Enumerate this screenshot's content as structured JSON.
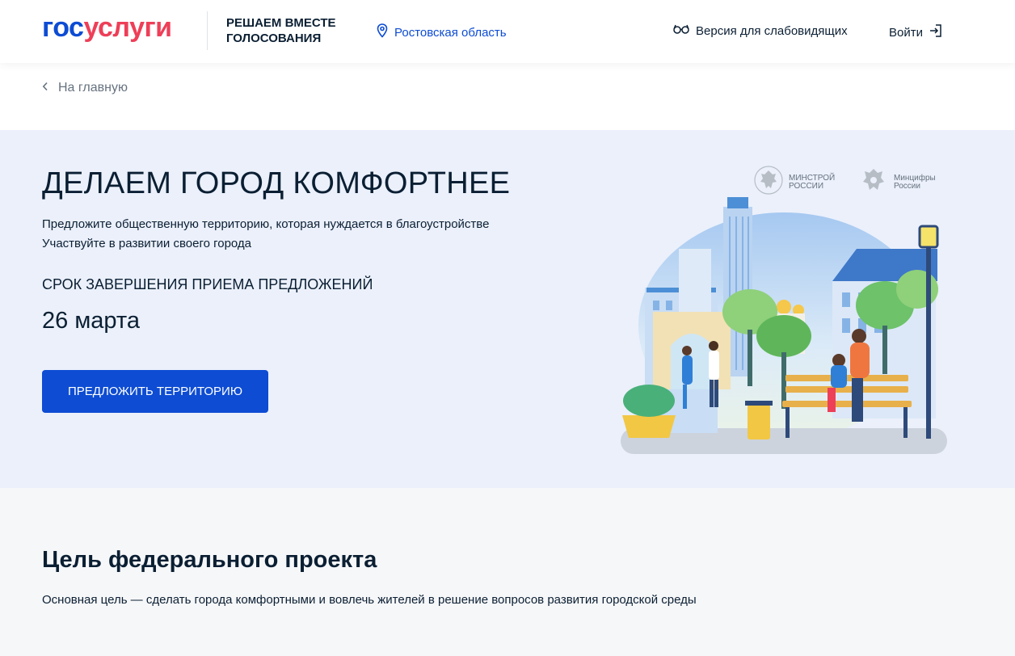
{
  "header": {
    "logo_part1": "гос",
    "logo_part2": "услуги",
    "project_line1": "РЕШАЕМ ВМЕСТЕ",
    "project_line2": "ГОЛОСОВАНИЯ",
    "region": "Ростовская область",
    "accessibility": "Версия для слабовидящих",
    "login": "Войти"
  },
  "breadcrumb": {
    "back": "На главную"
  },
  "hero": {
    "title": "ДЕЛАЕМ ГОРОД КОМФОРТНЕЕ",
    "subtitle1": "Предложите общественную территорию, которая нуждается в благоустройстве",
    "subtitle2": "Участвуйте в развитии своего города",
    "deadline_label": "СРОК ЗАВЕРШЕНИЯ ПРИЕМА ПРЕДЛОЖЕНИЙ",
    "deadline_date": "26 марта",
    "cta": "ПРЕДЛОЖИТЬ ТЕРРИТОРИЮ",
    "ministries": [
      "МИНСТРОЙ\nРОССИИ",
      "Минцифры\nРоссии"
    ]
  },
  "goal": {
    "title": "Цель федерального проекта",
    "text": "Основная цель — сделать города комфортными и вовлечь жителей в решение вопросов развития городской среды"
  },
  "colors": {
    "brand_blue": "#0d4cd3",
    "brand_red": "#ee3f58",
    "hero_bg": "#ebf0fb"
  },
  "icons": [
    "location-pin-icon",
    "glasses-icon",
    "login-arrow-icon",
    "chevron-left-icon",
    "coat-of-arms-icon"
  ]
}
